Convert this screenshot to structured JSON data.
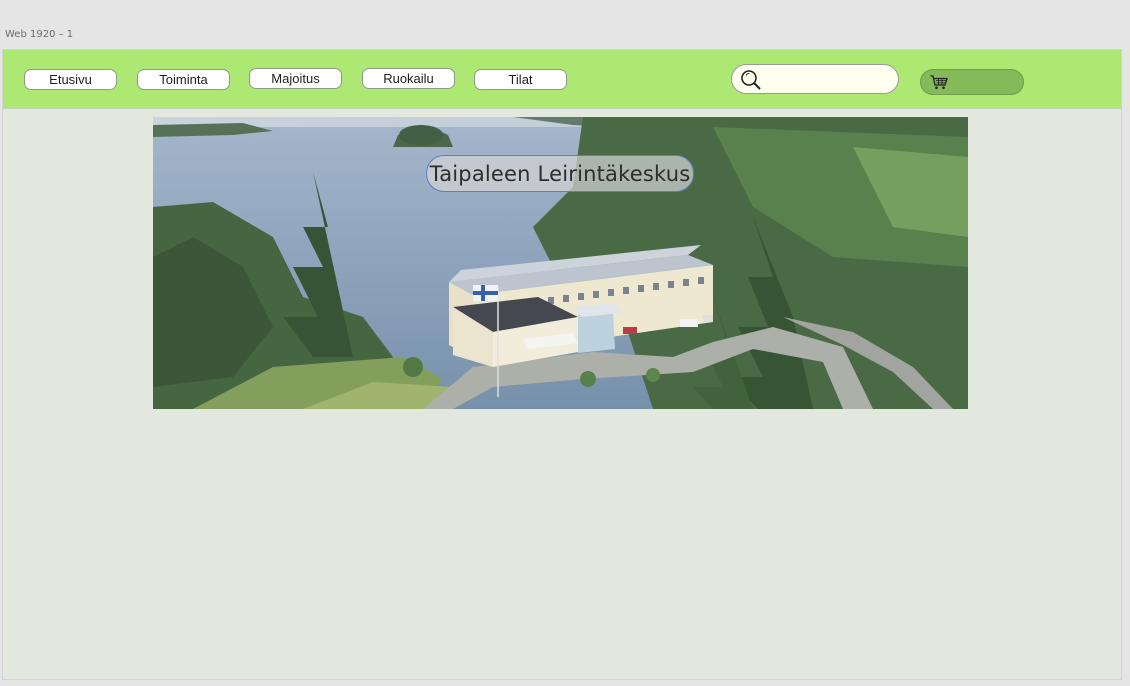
{
  "artboard": {
    "label": "Web 1920 – 1"
  },
  "nav": {
    "items": [
      {
        "label": "Etusivu"
      },
      {
        "label": "Toiminta"
      },
      {
        "label": "Majoitus"
      },
      {
        "label": "Ruokailu"
      },
      {
        "label": "Tilat"
      }
    ]
  },
  "search": {
    "value": "",
    "placeholder": "",
    "icon": "search-icon"
  },
  "cart": {
    "icon": "shopping-cart-icon"
  },
  "hero": {
    "title": "Taipaleen Leirintäkeskus",
    "image": "aerial photo of lakeside camp building surrounded by forest"
  },
  "colors": {
    "navbar": "#ade873",
    "cart_button": "#84ba5a",
    "canvas": "#e3e8df",
    "title_border": "#5b7fbf"
  }
}
